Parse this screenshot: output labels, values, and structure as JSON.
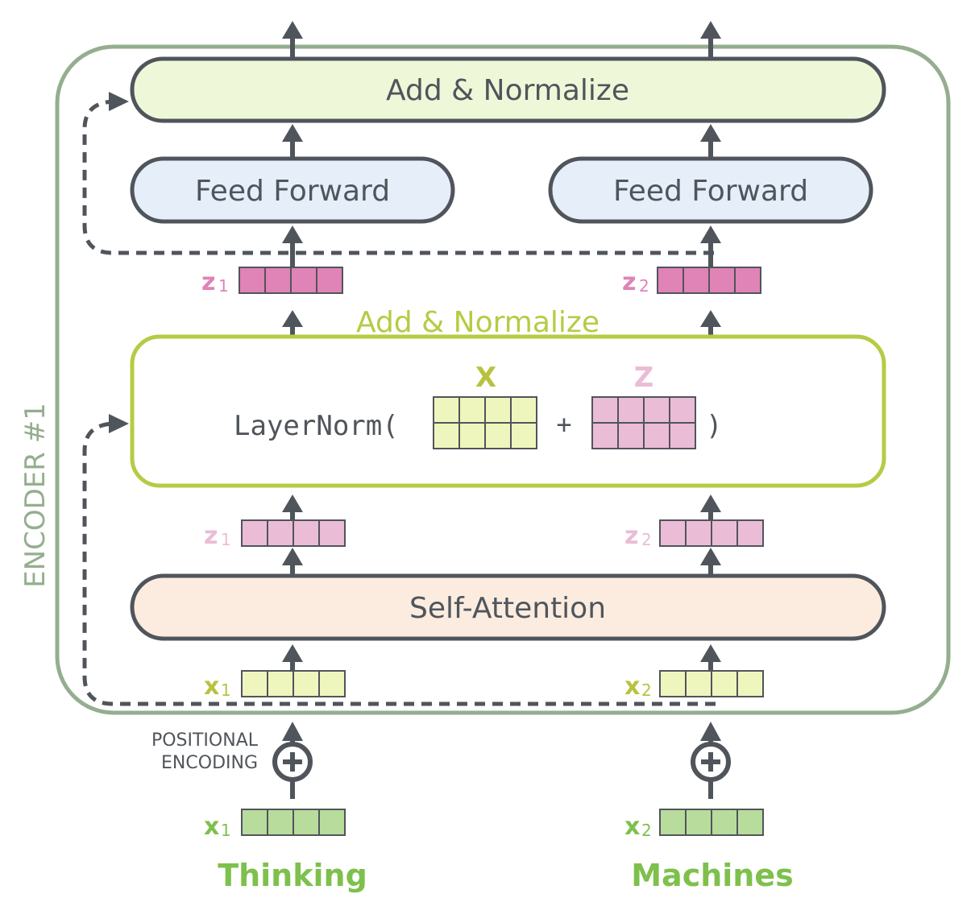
{
  "encoder_label": "ENCODER #1",
  "top_add_norm": {
    "label": "Add & Normalize"
  },
  "feed_forward": [
    {
      "label": "Feed Forward"
    },
    {
      "label": "Feed Forward"
    }
  ],
  "z_outputs": [
    {
      "name": "z",
      "sub": "1"
    },
    {
      "name": "z",
      "sub": "2"
    }
  ],
  "add_norm_expanded": {
    "title": "Add & Normalize",
    "formula_prefix": "LayerNorm(",
    "plus": "+",
    "formula_suffix": ")",
    "x_label": "X",
    "z_label": "Z"
  },
  "z_inputs": [
    {
      "name": "z",
      "sub": "1"
    },
    {
      "name": "z",
      "sub": "2"
    }
  ],
  "self_attention": {
    "label": "Self-Attention"
  },
  "x_embedded": [
    {
      "name": "x",
      "sub": "1"
    },
    {
      "name": "x",
      "sub": "2"
    }
  ],
  "positional_encoding": {
    "line1": "POSITIONAL",
    "line2": "ENCODING"
  },
  "x_inputs": [
    {
      "name": "x",
      "sub": "1"
    },
    {
      "name": "x",
      "sub": "2"
    }
  ],
  "words": [
    "Thinking",
    "Machines"
  ],
  "colors": {
    "encoder_border": "#94ae8f",
    "dark": "#50555c",
    "add_norm_fill": "#eef8d9",
    "feed_forward_fill": "#e6eefa",
    "self_attention_fill": "#fbecdf",
    "layernorm_border": "#b4cc44",
    "z_dark": "#e083b6",
    "z_light": "#ebbcd6",
    "x_yellow_fill": "#eff6bd",
    "x_yellow_text": "#b9c23f",
    "x_green_fill": "#b8dc9c",
    "x_green_text": "#7ec04c"
  }
}
